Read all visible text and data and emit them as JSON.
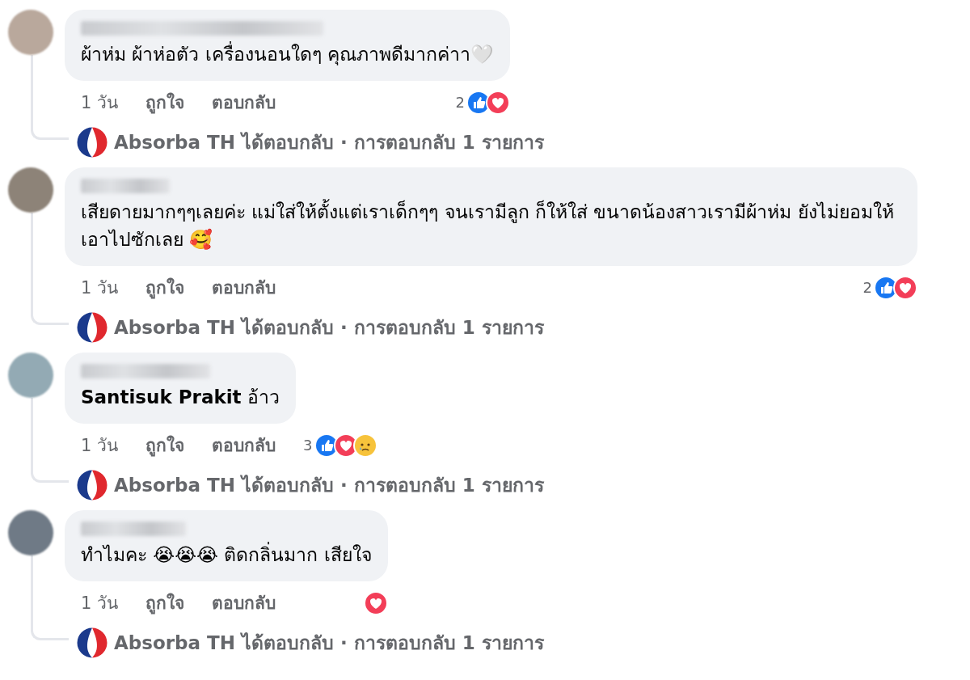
{
  "comments": [
    {
      "body": "ผ้าห่ม ผ้าห่อตัว เครื่องนอนใดๆ คุณภาพดีมากค่าา🤍",
      "time": "1 วัน",
      "like_action": "ถูกใจ",
      "reply_action": "ตอบกลับ",
      "reaction_count": "2",
      "reactions": [
        {
          "kind": "like"
        },
        {
          "kind": "love"
        }
      ],
      "reply": {
        "author": "Absorba TH",
        "summary": "ได้ตอบกลับ · การตอบกลับ 1 รายการ"
      }
    },
    {
      "body": "เสียดายมากๆๆเลยค่ะ แม่ใส่ให้ตั้งแต่เราเด็กๆๆ จนเรามีลูก ก็ให้ใส่ ขนาดน้องสาวเรามีผ้าห่ม ยังไม่ยอมให้เอาไปซักเลย 🥰",
      "time": "1 วัน",
      "like_action": "ถูกใจ",
      "reply_action": "ตอบกลับ",
      "reaction_count": "2",
      "reactions": [
        {
          "kind": "like"
        },
        {
          "kind": "love"
        }
      ],
      "reply": {
        "author": "Absorba TH",
        "summary": "ได้ตอบกลับ · การตอบกลับ 1 รายการ"
      }
    },
    {
      "body": "**Santisuk Prakit** อ้าว",
      "time": "1 วัน",
      "like_action": "ถูกใจ",
      "reply_action": "ตอบกลับ",
      "reaction_count": "3",
      "reactions": [
        {
          "kind": "like"
        },
        {
          "kind": "love"
        },
        {
          "kind": "sad"
        }
      ],
      "reply": {
        "author": "Absorba TH",
        "summary": "ได้ตอบกลับ · การตอบกลับ 1 รายการ"
      }
    },
    {
      "body": "ทำไมคะ 😭😭😭 ติดกลิ่นมาก เสียใจ",
      "time": "1 วัน",
      "like_action": "ถูกใจ",
      "reply_action": "ตอบกลับ",
      "reactions": [
        {
          "kind": "love"
        }
      ],
      "reply": {
        "author": "Absorba TH",
        "summary": "ได้ตอบกลับ · การตอบกลับ 1 รายการ"
      }
    }
  ]
}
